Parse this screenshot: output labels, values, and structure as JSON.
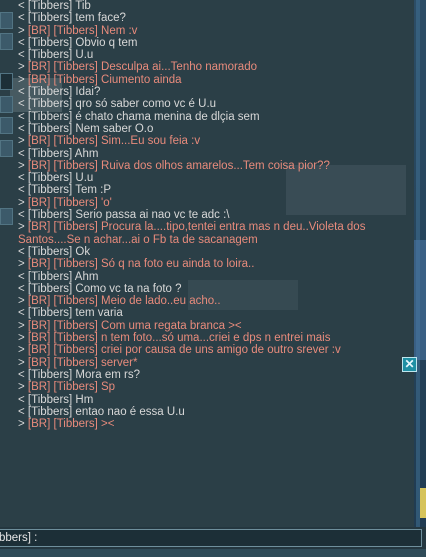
{
  "chat": {
    "lines": [
      {
        "dir": "<",
        "tag": "",
        "nick": "[Tibbers]",
        "text": " Tib"
      },
      {
        "dir": "<",
        "tag": "",
        "nick": "[Tibbers]",
        "text": " tem face?"
      },
      {
        "dir": ">",
        "tag": "[BR]",
        "nick": "[Tibbers]",
        "text": " Nem :v"
      },
      {
        "dir": "<",
        "tag": "",
        "nick": "[Tibbers]",
        "text": " Obvio q tem"
      },
      {
        "dir": "<",
        "tag": "",
        "nick": "[Tibbers]",
        "text": " U.u"
      },
      {
        "dir": ">",
        "tag": "[BR]",
        "nick": "[Tibbers]",
        "text": " Desculpa ai...Tenho namorado"
      },
      {
        "dir": ">",
        "tag": "[BR]",
        "nick": "[Tibbers]",
        "text": " Ciumento ainda"
      },
      {
        "dir": "<",
        "tag": "",
        "nick": "[Tibbers]",
        "text": " Idai?"
      },
      {
        "dir": "<",
        "tag": "",
        "nick": "[Tibbers]",
        "text": " qro só saber como vc é U.u"
      },
      {
        "dir": "<",
        "tag": "",
        "nick": "[Tibbers]",
        "text": " é chato chama menina de dlçia sem"
      },
      {
        "dir": "<",
        "tag": "",
        "nick": "[Tibbers]",
        "text": " Nem saber O.o"
      },
      {
        "dir": ">",
        "tag": "[BR]",
        "nick": "[Tibbers]",
        "text": " Sim...Eu sou feia :v"
      },
      {
        "dir": "<",
        "tag": "",
        "nick": "[Tibbers]",
        "text": " Ahm"
      },
      {
        "dir": ">",
        "tag": "[BR]",
        "nick": "[Tibbers]",
        "text": " Ruiva dos olhos amarelos...Tem coisa pior??"
      },
      {
        "dir": "<",
        "tag": "",
        "nick": "[Tibbers]",
        "text": " U.u"
      },
      {
        "dir": "<",
        "tag": "",
        "nick": "[Tibbers]",
        "text": " Tem :P"
      },
      {
        "dir": ">",
        "tag": "[BR]",
        "nick": "[Tibbers]",
        "text": " 'o'"
      },
      {
        "dir": "<",
        "tag": "",
        "nick": "[Tibbers]",
        "text": " Serio passa ai nao vc te adc :\\"
      },
      {
        "dir": ">",
        "tag": "[BR]",
        "nick": "[Tibbers]",
        "text": " Procura la....tipo,tentei entra mas n deu..Violeta dos Santos....Se n achar...ai o Fb ta de sacanagem"
      },
      {
        "dir": "<",
        "tag": "",
        "nick": "[Tibbers]",
        "text": " Ok"
      },
      {
        "dir": ">",
        "tag": "[BR]",
        "nick": "[Tibbers]",
        "text": " Só q na foto eu ainda to loira.."
      },
      {
        "dir": "<",
        "tag": "",
        "nick": "[Tibbers]",
        "text": " Ahm"
      },
      {
        "dir": "<",
        "tag": "",
        "nick": "[Tibbers]",
        "text": " Como vc ta na foto ?"
      },
      {
        "dir": ">",
        "tag": "[BR]",
        "nick": "[Tibbers]",
        "text": " Meio de lado..eu acho.."
      },
      {
        "dir": "<",
        "tag": "",
        "nick": "[Tibbers]",
        "text": " tem varia"
      },
      {
        "dir": ">",
        "tag": "[BR]",
        "nick": "[Tibbers]",
        "text": " Com uma regata branca ><"
      },
      {
        "dir": ">",
        "tag": "[BR]",
        "nick": "[Tibbers]",
        "text": " n tem foto...só uma...criei e dps n entrei mais"
      },
      {
        "dir": ">",
        "tag": "[BR]",
        "nick": "[Tibbers]",
        "text": " criei por causa de uns amigo de outro srever :v"
      },
      {
        "dir": ">",
        "tag": "[BR]",
        "nick": "[Tibbers]",
        "text": " server*"
      },
      {
        "dir": "<",
        "tag": "",
        "nick": "[Tibbers]",
        "text": " Mora em rs?"
      },
      {
        "dir": ">",
        "tag": "[BR]",
        "nick": "[Tibbers]",
        "text": " Sp"
      },
      {
        "dir": "<",
        "tag": "",
        "nick": "[Tibbers]",
        "text": " Hm"
      },
      {
        "dir": "<",
        "tag": "",
        "nick": "[Tibbers]",
        "text": " entao nao é essa U.u"
      },
      {
        "dir": ">",
        "tag": "[BR]",
        "nick": "[Tibbers]",
        "text": " ><"
      }
    ]
  },
  "input": {
    "prefix": "bbers] :"
  },
  "close_button": {
    "icon": "close-icon",
    "glyph": "✕"
  },
  "colors": {
    "outgoing": "#e88b7c",
    "incoming": "#d8d8d8",
    "panel": "#2b3f47"
  }
}
